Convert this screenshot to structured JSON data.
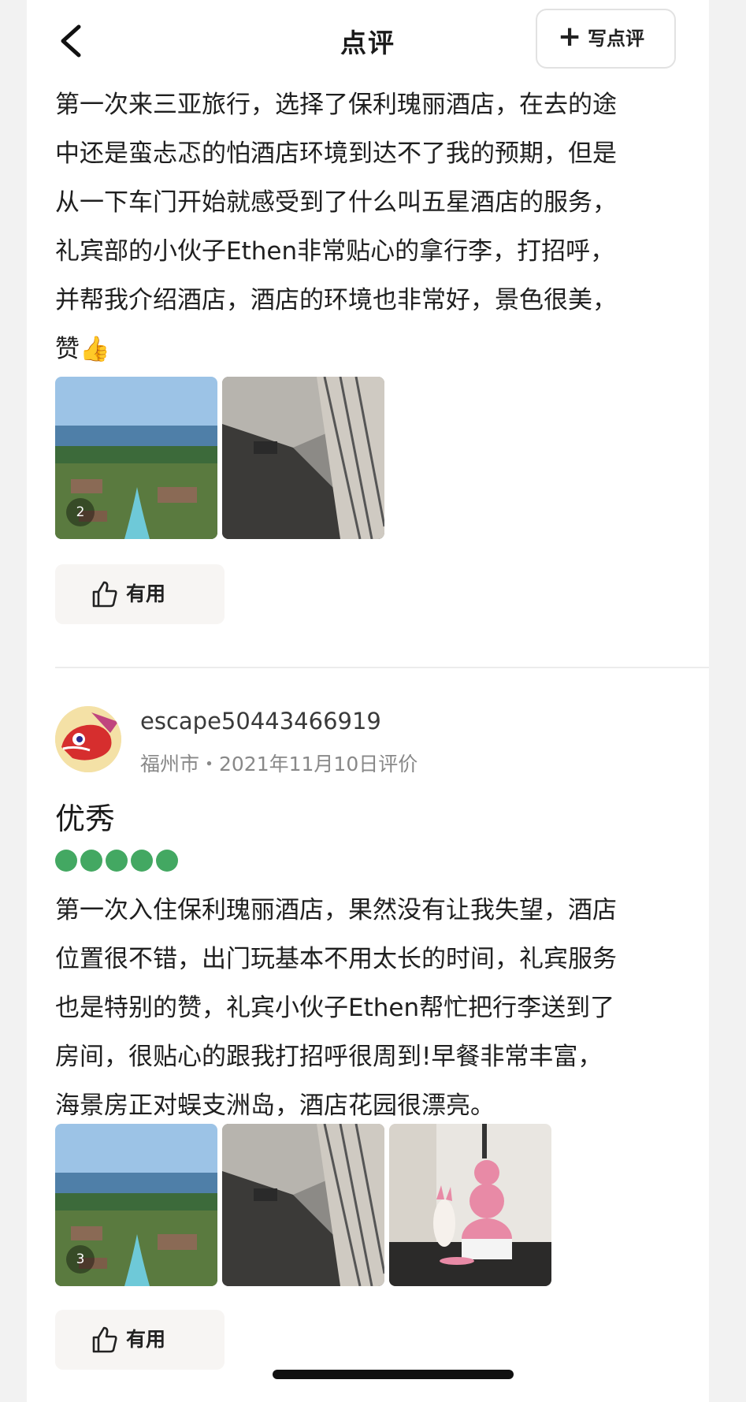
{
  "header": {
    "title": "点评",
    "write_button_plus": "+",
    "write_button_label": "写点评"
  },
  "review1": {
    "lines": [
      "第一次来三亚旅行，选择了保利瑰丽酒店，在去的途",
      "中还是蛮忐忑的怕酒店环境到达不了我的预期，但是",
      "从一下车门开始就感受到了什么叫五星酒店的服务，",
      "礼宾部的小伙子Ethen非常贴心的拿行李，打招呼，",
      "并帮我介绍酒店，酒店的环境也非常好，景色很美，",
      "赞👍"
    ],
    "photo_count": "2",
    "useful_label": "有用"
  },
  "review2": {
    "username": "escape50443466919",
    "meta": "福州市・2021年11月10日评价",
    "rating_title": "优秀",
    "rating": 5,
    "lines": [
      "第一次入住保利瑰丽酒店，果然没有让我失望，酒店",
      "位置很不错，出门玩基本不用太长的时间，礼宾服务",
      "也是特别的赞，礼宾小伙子Ethen帮忙把行李送到了",
      "房间，很贴心的跟我打招呼很周到!早餐非常丰富，",
      "海景房正对蜈支洲岛，酒店花园很漂亮。"
    ],
    "photo_count": "3",
    "useful_label": "有用"
  },
  "colors": {
    "rating_dot": "#43a862",
    "text": "#1f1f1f",
    "meta": "#888888"
  }
}
